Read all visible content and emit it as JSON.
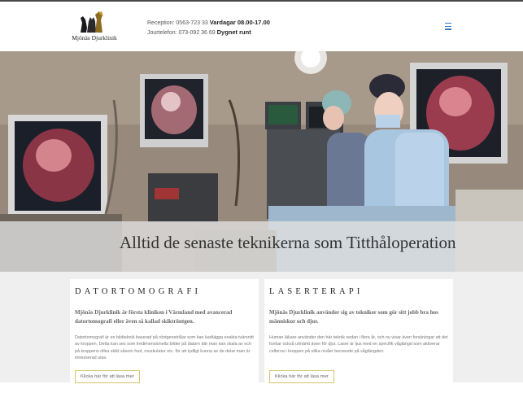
{
  "header": {
    "logo_text": "Mjönäs Djurklinik",
    "reception_label": "Reception: 0563-723 33",
    "reception_hours": "Vardagar 08.00-17.00",
    "emergency_label": "Jourtelefon: 073-092 36 69",
    "emergency_hours": "Dygnet runt"
  },
  "hero": {
    "title": "Alltid de senaste teknikerna som Titthåloperation"
  },
  "cards": [
    {
      "title": "DATORTOMOGRAFI",
      "lead": "Mjönäs Djurklinik är första kliniken i Värmland med avancerad datortomografi eller även så kallad skiktröntgen.",
      "body": "Datortomografi är en bildteknik baserad på röntgenstrålar som kan kartlägga exakta tvärsnitt av kroppen. Detta kan ses som tredimensionella bilder på datorn där man kan skala av och på kroppens olika skikt såsom hud, muskulatur etc. för att tydligt kunna se de delar man är intresserad utav.",
      "button": "Klicka här för att läsa mer"
    },
    {
      "title": "LASERTERAPI",
      "lead": "Mjönäs Djurklinik använder sig av tekniker som gör sitt jobb bra hos människor och djur.",
      "body": "Human läkare använder den här teknik sedan i flera år, och nu visar även forskningar att det funkar också utmärkt även för djur. Laser är ljus med en specifik våglängd som aktiverar cellerna i kroppen på olika nivåer beroende på våglängden.",
      "button": "Klicka här för att läsa mer"
    }
  ],
  "colors": {
    "accent_gold": "#d9c56a",
    "menu_blue": "#3a78c4"
  }
}
